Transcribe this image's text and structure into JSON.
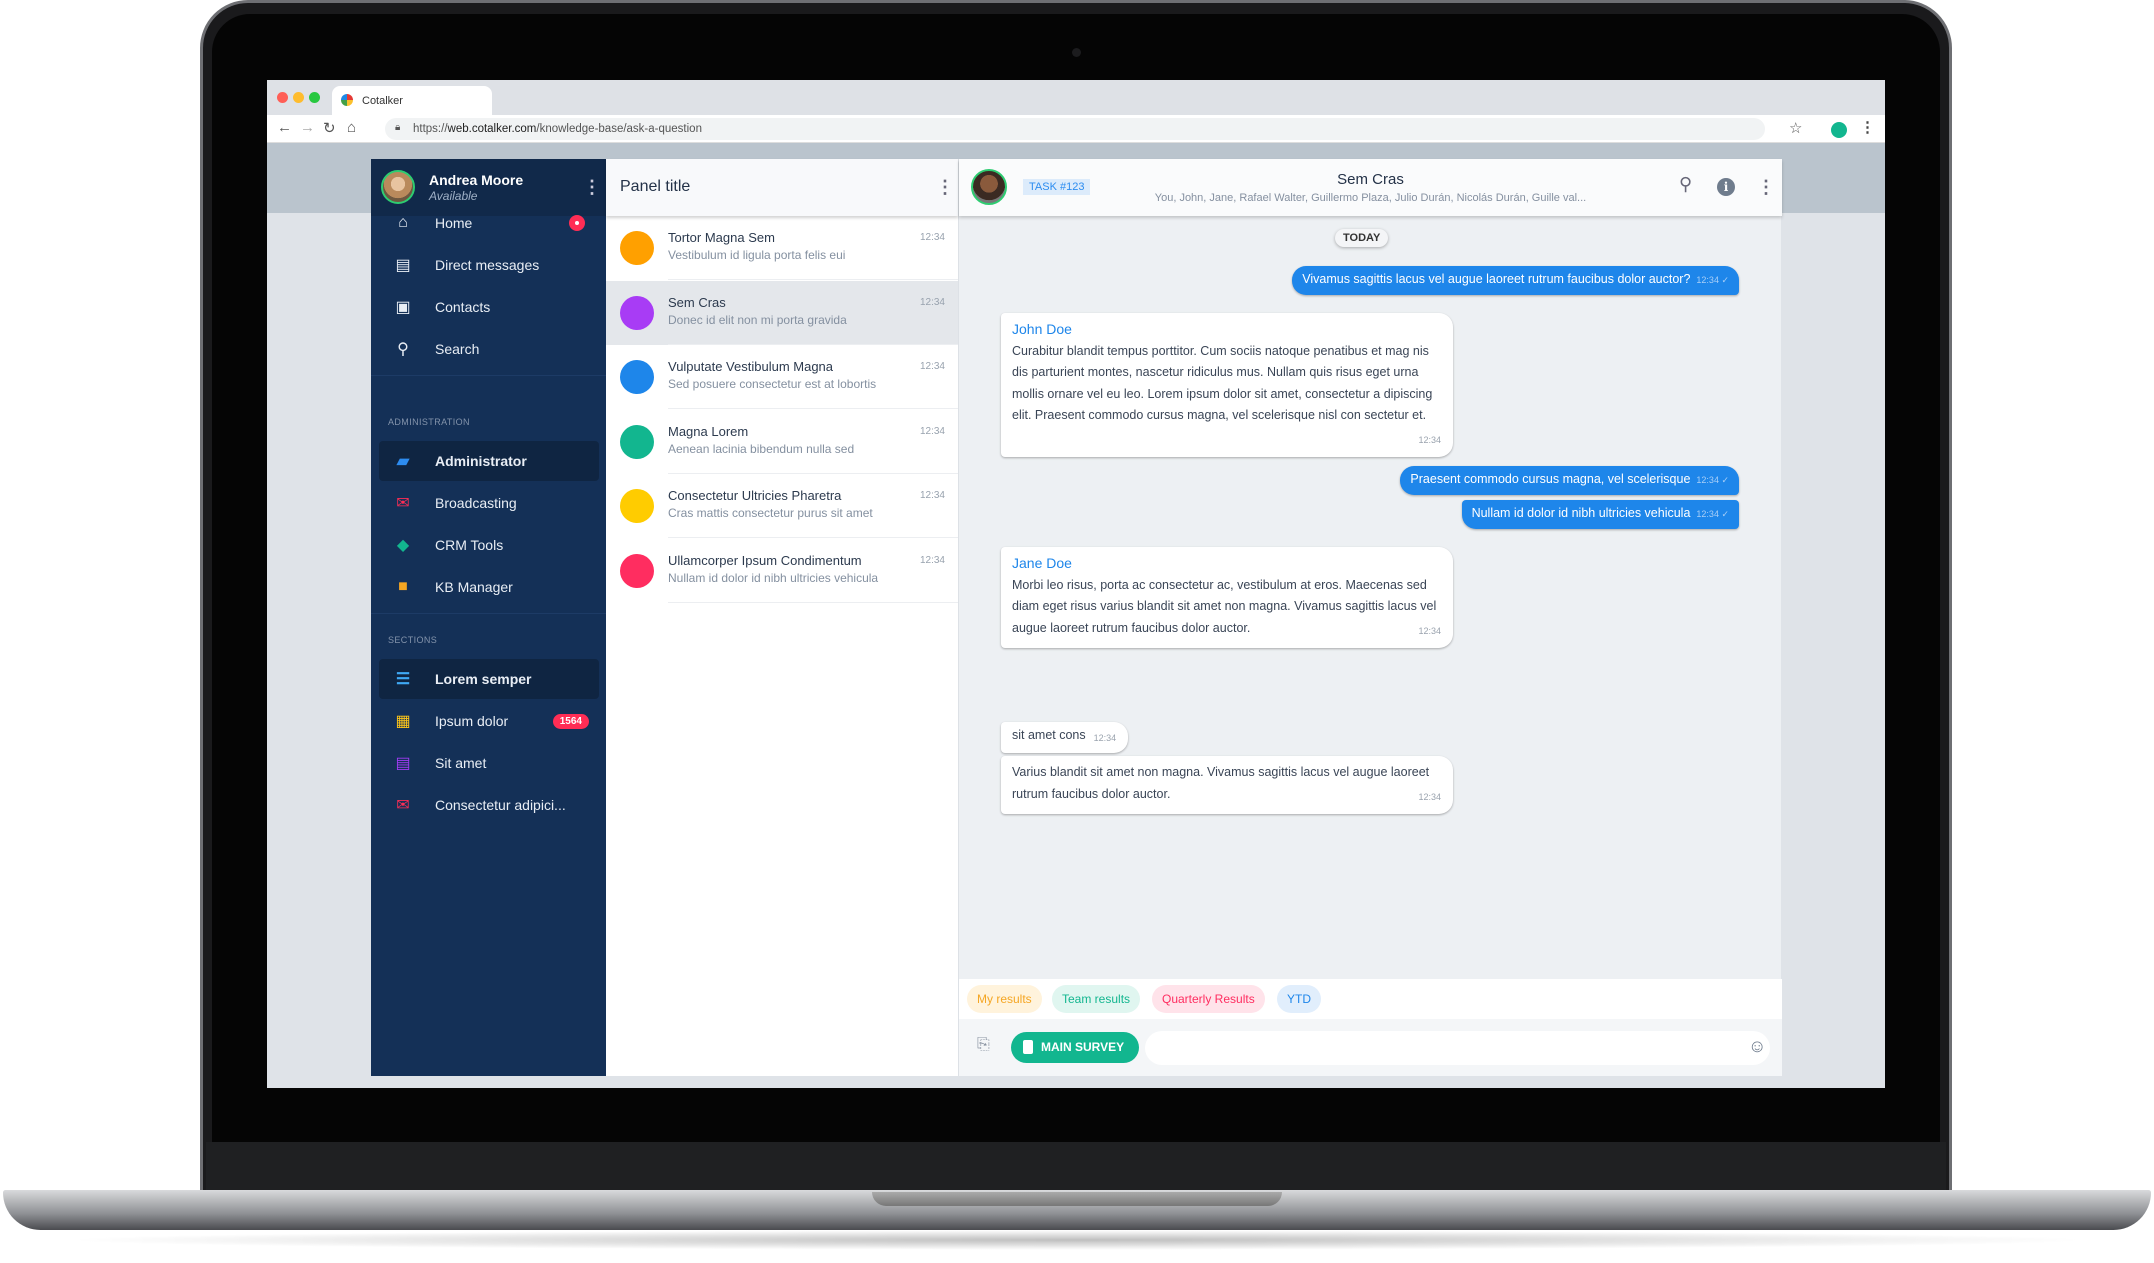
{
  "browser": {
    "tab_title": "Cotalker",
    "url_prefix": "https://",
    "url_host": "web.cotalker.com",
    "url_path": "/knowledge-base/ask-a-question"
  },
  "sidebar": {
    "user": {
      "name": "Andrea Moore",
      "status": "Available"
    },
    "main_items": [
      {
        "label": "Home",
        "icon": "home-icon",
        "dot": true
      },
      {
        "label": "Direct messages",
        "icon": "chat-icon"
      },
      {
        "label": "Contacts",
        "icon": "contact-card-icon"
      },
      {
        "label": "Search",
        "icon": "search-icon"
      }
    ],
    "admin_header": "ADMINISTRATION",
    "admin_items": [
      {
        "label": "Administrator",
        "icon": "toolbox-icon",
        "active": true,
        "color": "#2d8cf0"
      },
      {
        "label": "Broadcasting",
        "icon": "mail-stack-icon",
        "color": "#ff2d55"
      },
      {
        "label": "CRM Tools",
        "icon": "handshake-icon",
        "color": "#12b68f"
      },
      {
        "label": "KB Manager",
        "icon": "book-reader-icon",
        "color": "#f5a623"
      }
    ],
    "sections_header": "SECTIONS",
    "section_items": [
      {
        "label": "Lorem semper",
        "icon": "database-icon",
        "active": true,
        "color": "#3fa9f5"
      },
      {
        "label": "Ipsum dolor",
        "icon": "building-icon",
        "badge": "1564",
        "color": "#fcc419"
      },
      {
        "label": "Sit amet",
        "icon": "clipboard-icon",
        "color": "#a23cf5"
      },
      {
        "label": "Consectetur adipici...",
        "icon": "mail-icon",
        "color": "#ff2d55"
      }
    ]
  },
  "list": {
    "title": "Panel title",
    "items": [
      {
        "title": "Tortor Magna Sem",
        "subtitle": "Vestibulum id ligula porta felis eui",
        "time": "12:34",
        "color": "#ffa000"
      },
      {
        "title": "Sem Cras",
        "subtitle": "Donec id elit non mi porta gravida",
        "time": "12:34",
        "color": "#a83cf5",
        "selected": true
      },
      {
        "title": "Vulputate Vestibulum Magna",
        "subtitle": "Sed posuere consectetur est at lobortis",
        "time": "12:34",
        "color": "#1e86ea"
      },
      {
        "title": "Magna Lorem",
        "subtitle": "Aenean lacinia bibendum nulla sed",
        "time": "12:34",
        "color": "#12b68f"
      },
      {
        "title": "Consectetur Ultricies Pharetra",
        "subtitle": "Cras mattis consectetur purus sit amet",
        "time": "12:34",
        "color": "#ffcc00"
      },
      {
        "title": "Ullamcorper Ipsum Condimentum",
        "subtitle": "Nullam id dolor id nibh ultricies vehicula",
        "time": "12:34",
        "color": "#ff2d60"
      }
    ]
  },
  "chat": {
    "task": "TASK #123",
    "title": "Sem Cras",
    "participants": "You, John, Jane, Rafael Walter, Guillermo Plaza, Julio Durán, Nicolás Durán, Guille val...",
    "date_divider": "TODAY",
    "messages": [
      {
        "dir": "out",
        "text": "Vivamus sagittis lacus vel augue laoreet rutrum faucibus dolor auctor?",
        "time": "12:34 ✓"
      },
      {
        "dir": "in",
        "author": "John Doe",
        "text": "Curabitur blandit tempus porttitor. Cum sociis natoque penatibus et mag nis dis parturient montes, nascetur ridiculus mus. Nullam quis risus eget urna mollis ornare vel eu leo. Lorem ipsum dolor sit amet, consectetur a dipiscing elit. Praesent commodo cursus magna, vel scelerisque nisl con sectetur et.",
        "time": "12:34"
      },
      {
        "dir": "out",
        "text": "Praesent commodo cursus magna, vel scelerisque",
        "time": "12:34 ✓"
      },
      {
        "dir": "out",
        "text": "Nullam id dolor id nibh ultricies vehicula",
        "time": "12:34 ✓"
      },
      {
        "dir": "in",
        "author": "Jane Doe",
        "text": "Morbi leo risus, porta ac consectetur ac, vestibulum at eros. Maecenas sed diam eget risus varius blandit sit amet non magna. Vivamus sagittis lacus vel augue laoreet rutrum faucibus dolor auctor.",
        "time": "12:34"
      },
      {
        "dir": "in",
        "text": "sit amet cons",
        "time": "12:34"
      },
      {
        "dir": "in",
        "text": "Varius blandit sit amet non magna. Vivamus sagittis lacus vel augue laoreet rutrum faucibus dolor auctor.",
        "time": "12:34"
      }
    ],
    "chips": [
      {
        "label": "My results",
        "fg": "#f5a623",
        "bg": "#fff3dc"
      },
      {
        "label": "Team results",
        "fg": "#12b68f",
        "bg": "#e0f6f0"
      },
      {
        "label": "Quarterly Results",
        "fg": "#ff2d60",
        "bg": "#ffe3ea"
      },
      {
        "label": "YTD",
        "fg": "#1e86ea",
        "bg": "#e1eefc"
      }
    ],
    "survey_button": "MAIN SURVEY",
    "input_placeholder": ""
  }
}
